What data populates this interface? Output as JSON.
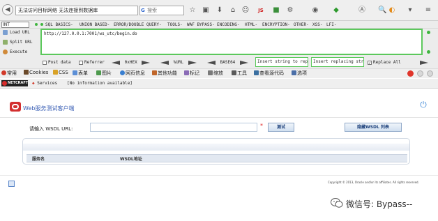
{
  "browser": {
    "tab_title": "无法访问目标网络  无法连接到数据库",
    "search_placeholder": "搜索",
    "search_glyph": "G"
  },
  "hackbar": {
    "mode_select": "INT",
    "menu": [
      "SQL BASICS-",
      "UNION BASED-",
      "ERROR/DOUBLE QUERY-",
      "TOOLS-",
      "WAF BYPASS-",
      "ENCODING-",
      "HTML-",
      "ENCRYPTION-",
      "OTHER-",
      "XSS-",
      "LFI-"
    ],
    "side": {
      "load": "Load URL",
      "split": "Split URL",
      "execute": "Execute"
    },
    "url_value": "http://127.0.0.1:7001/ws_utc/begin.do",
    "post_data": "Post data",
    "referrer": "Referrer",
    "hex": "0xHEX",
    "url": "%URL",
    "base64": "BASE64",
    "find_placeholder": "Insert string to repl",
    "replace_placeholder": "Insert replacing strin",
    "replace_all": "Replace All"
  },
  "toolbar2": [
    "常用",
    "Cookies",
    "CSS",
    "表单",
    "图片",
    "网页信息",
    "其他功能",
    "标记",
    "缩放",
    "工具",
    "查看源代码",
    "选项"
  ],
  "toolbar3": {
    "netcraft": "NETCRAFT",
    "services": "Services",
    "info": "[No information available]"
  },
  "app": {
    "title": "Web服务测试客户端",
    "wsdl_label": "请输入 WSDL URL:",
    "wsdl_value": "",
    "required_mark": "*",
    "test_button": "测试",
    "hide_button": "隐藏WSDL 列表",
    "col_service": "服务名",
    "col_address": "WSDL地址",
    "copyright": "Copyright © 2013, Oracle and/or its affiliates. All rights reserved."
  },
  "watermark": "微信号: Bypass--",
  "colors": {
    "accent_green": "#5cc85c",
    "oracle_red": "#d32f2f",
    "link_blue": "#3a5fb5"
  }
}
